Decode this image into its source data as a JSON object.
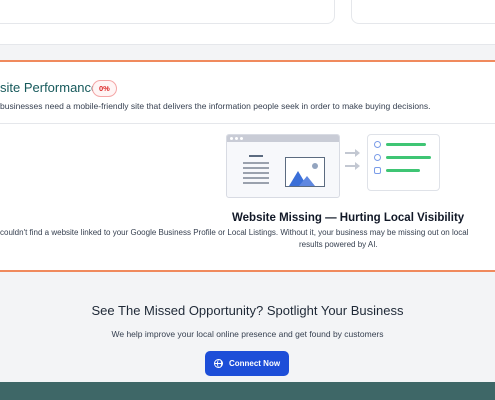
{
  "section": {
    "title": "site Performance",
    "badge": "0%",
    "description": "businesses need a mobile-friendly site that delivers the information people seek in order to make buying decisions."
  },
  "issue": {
    "title": "Website Missing — Hurting Local Visibility",
    "description_line1": "couldn't find a website linked to your Google Business Profile or Local Listings. Without it, your business may be missing out on local",
    "description_line2": "results powered by AI.",
    "illustration_icon": "website-missing-illustration"
  },
  "cta": {
    "title": "See The Missed Opportunity? Spotlight Your Business",
    "subtitle": "We help improve your local online presence and get found by customers",
    "button_label": "Connect Now",
    "button_icon": "globe-icon"
  },
  "colors": {
    "accent_border": "#f08a5d",
    "title_teal": "#16595b",
    "badge_red": "#dc2626",
    "button_blue": "#1d4ed8",
    "bottom_band": "#3e6767",
    "list_green": "#3fc574"
  }
}
